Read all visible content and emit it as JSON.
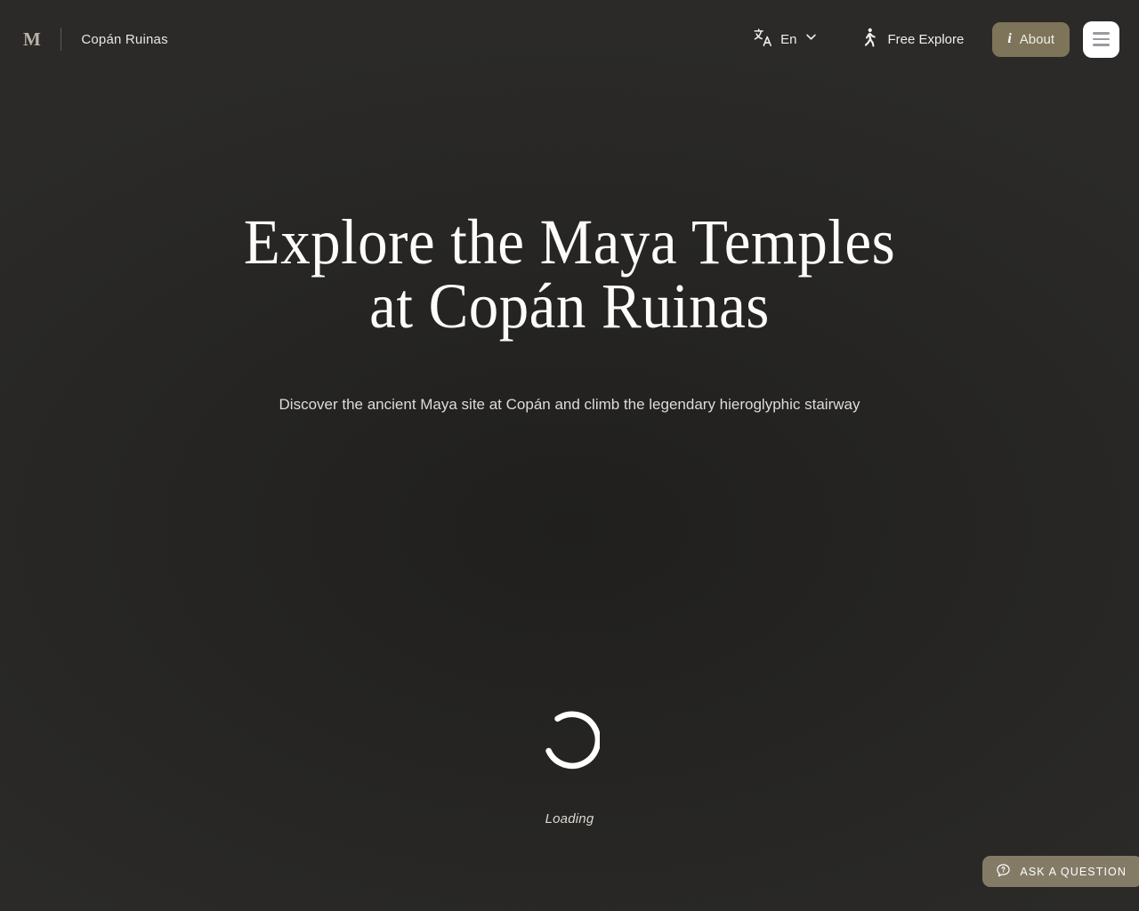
{
  "theme": {
    "background": "#2a2927",
    "accent": "#7d7459",
    "accent_button": "#847b67",
    "text_primary": "#fdfcfa",
    "text_secondary": "#dedcd7",
    "menu_button_bg": "#ffffff"
  },
  "header": {
    "logo_mark": "M",
    "site_name": "Copán Ruinas",
    "language": {
      "icon": "translate-icon",
      "value": "En",
      "chevron": "chevron-down-icon"
    },
    "free_explore": {
      "icon": "walking-person-icon",
      "label": "Free Explore"
    },
    "about": {
      "icon": "info-icon",
      "icon_glyph": "i",
      "label": "About"
    },
    "menu": {
      "icon": "hamburger-menu-icon"
    }
  },
  "hero": {
    "title": "Explore the Maya Temples\nat Copán Ruinas",
    "subtitle": "Discover the ancient Maya site at Copán and climb the legendary hieroglyphic stairway"
  },
  "loader": {
    "icon": "loading-spinner-icon",
    "label": "Loading"
  },
  "ask": {
    "icon": "question-bubble-icon",
    "label": "ASK A QUESTION"
  }
}
